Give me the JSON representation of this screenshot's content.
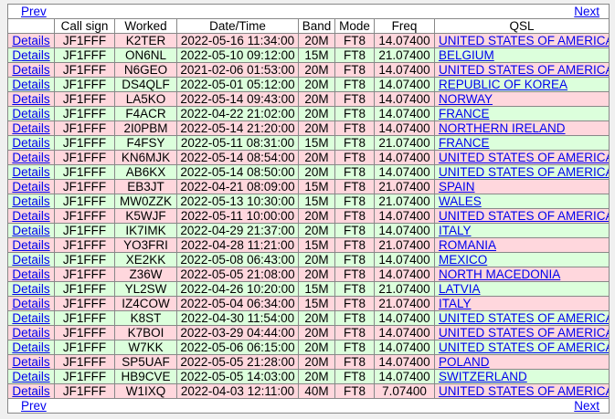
{
  "nav": {
    "prev": "Prev",
    "next": "Next"
  },
  "headers": [
    "",
    "Call sign",
    "Worked",
    "Date/Time",
    "Band",
    "Mode",
    "Freq",
    "QSL"
  ],
  "details_label": "Details",
  "rows": [
    {
      "color": "pink",
      "call": "JF1FFF",
      "worked": "K2TER",
      "dt": "2022-05-16 11:34:00",
      "band": "20M",
      "mode": "FT8",
      "freq": "14.07400",
      "qsl": "UNITED STATES OF AMERICA"
    },
    {
      "color": "green",
      "call": "JF1FFF",
      "worked": "ON6NL",
      "dt": "2022-05-10 09:12:00",
      "band": "15M",
      "mode": "FT8",
      "freq": "21.07400",
      "qsl": "BELGIUM"
    },
    {
      "color": "pink",
      "call": "JF1FFF",
      "worked": "N6GEO",
      "dt": "2021-02-06 01:53:00",
      "band": "20M",
      "mode": "FT8",
      "freq": "14.07400",
      "qsl": "UNITED STATES OF AMERICA"
    },
    {
      "color": "green",
      "call": "JF1FFF",
      "worked": "DS4QLF",
      "dt": "2022-05-01 05:12:00",
      "band": "20M",
      "mode": "FT8",
      "freq": "14.07400",
      "qsl": "REPUBLIC OF KOREA"
    },
    {
      "color": "pink",
      "call": "JF1FFF",
      "worked": "LA5KO",
      "dt": "2022-05-14 09:43:00",
      "band": "20M",
      "mode": "FT8",
      "freq": "14.07400",
      "qsl": "NORWAY"
    },
    {
      "color": "green",
      "call": "JF1FFF",
      "worked": "F4ACR",
      "dt": "2022-04-22 21:02:00",
      "band": "20M",
      "mode": "FT8",
      "freq": "14.07400",
      "qsl": "FRANCE"
    },
    {
      "color": "pink",
      "call": "JF1FFF",
      "worked": "2I0PBM",
      "dt": "2022-05-14 21:20:00",
      "band": "20M",
      "mode": "FT8",
      "freq": "14.07400",
      "qsl": "NORTHERN IRELAND"
    },
    {
      "color": "green",
      "call": "JF1FFF",
      "worked": "F4FSY",
      "dt": "2022-05-11 08:31:00",
      "band": "15M",
      "mode": "FT8",
      "freq": "21.07400",
      "qsl": "FRANCE"
    },
    {
      "color": "pink",
      "call": "JF1FFF",
      "worked": "KN6MJK",
      "dt": "2022-05-14 08:54:00",
      "band": "20M",
      "mode": "FT8",
      "freq": "14.07400",
      "qsl": "UNITED STATES OF AMERICA"
    },
    {
      "color": "green",
      "call": "JF1FFF",
      "worked": "AB6KX",
      "dt": "2022-05-14 08:50:00",
      "band": "20M",
      "mode": "FT8",
      "freq": "14.07400",
      "qsl": "UNITED STATES OF AMERICA"
    },
    {
      "color": "pink",
      "call": "JF1FFF",
      "worked": "EB3JT",
      "dt": "2022-04-21 08:09:00",
      "band": "15M",
      "mode": "FT8",
      "freq": "21.07400",
      "qsl": "SPAIN"
    },
    {
      "color": "green",
      "call": "JF1FFF",
      "worked": "MW0ZZK",
      "dt": "2022-05-13 10:30:00",
      "band": "15M",
      "mode": "FT8",
      "freq": "21.07400",
      "qsl": "WALES"
    },
    {
      "color": "pink",
      "call": "JF1FFF",
      "worked": "K5WJF",
      "dt": "2022-05-11 10:00:00",
      "band": "20M",
      "mode": "FT8",
      "freq": "14.07400",
      "qsl": "UNITED STATES OF AMERICA"
    },
    {
      "color": "green",
      "call": "JF1FFF",
      "worked": "IK7IMK",
      "dt": "2022-04-29 21:37:00",
      "band": "20M",
      "mode": "FT8",
      "freq": "14.07400",
      "qsl": "ITALY"
    },
    {
      "color": "pink",
      "call": "JF1FFF",
      "worked": "YO3FRI",
      "dt": "2022-04-28 11:21:00",
      "band": "15M",
      "mode": "FT8",
      "freq": "21.07400",
      "qsl": "ROMANIA"
    },
    {
      "color": "green",
      "call": "JF1FFF",
      "worked": "XE2KK",
      "dt": "2022-05-08 06:43:00",
      "band": "20M",
      "mode": "FT8",
      "freq": "14.07400",
      "qsl": "MEXICO"
    },
    {
      "color": "pink",
      "call": "JF1FFF",
      "worked": "Z36W",
      "dt": "2022-05-05 21:08:00",
      "band": "20M",
      "mode": "FT8",
      "freq": "14.07400",
      "qsl": "NORTH MACEDONIA"
    },
    {
      "color": "green",
      "call": "JF1FFF",
      "worked": "YL2SW",
      "dt": "2022-04-26 10:20:00",
      "band": "15M",
      "mode": "FT8",
      "freq": "21.07400",
      "qsl": "LATVIA"
    },
    {
      "color": "pink",
      "call": "JF1FFF",
      "worked": "IZ4COW",
      "dt": "2022-05-04 06:34:00",
      "band": "15M",
      "mode": "FT8",
      "freq": "21.07400",
      "qsl": "ITALY"
    },
    {
      "color": "green",
      "call": "JF1FFF",
      "worked": "K8ST",
      "dt": "2022-04-30 11:54:00",
      "band": "20M",
      "mode": "FT8",
      "freq": "14.07400",
      "qsl": "UNITED STATES OF AMERICA"
    },
    {
      "color": "pink",
      "call": "JF1FFF",
      "worked": "K7BOI",
      "dt": "2022-03-29 04:44:00",
      "band": "20M",
      "mode": "FT8",
      "freq": "14.07400",
      "qsl": "UNITED STATES OF AMERICA"
    },
    {
      "color": "green",
      "call": "JF1FFF",
      "worked": "W7KK",
      "dt": "2022-05-06 06:15:00",
      "band": "20M",
      "mode": "FT8",
      "freq": "14.07400",
      "qsl": "UNITED STATES OF AMERICA"
    },
    {
      "color": "pink",
      "call": "JF1FFF",
      "worked": "SP5UAF",
      "dt": "2022-05-05 21:28:00",
      "band": "20M",
      "mode": "FT8",
      "freq": "14.07400",
      "qsl": "POLAND"
    },
    {
      "color": "green",
      "call": "JF1FFF",
      "worked": "HB9CVE",
      "dt": "2022-05-05 14:03:00",
      "band": "20M",
      "mode": "FT8",
      "freq": "14.07400",
      "qsl": "SWITZERLAND"
    },
    {
      "color": "pink",
      "call": "JF1FFF",
      "worked": "W1IXQ",
      "dt": "2022-04-03 12:11:00",
      "band": "40M",
      "mode": "FT8",
      "freq": "7.07400",
      "qsl": "UNITED STATES OF AMERICA"
    }
  ]
}
